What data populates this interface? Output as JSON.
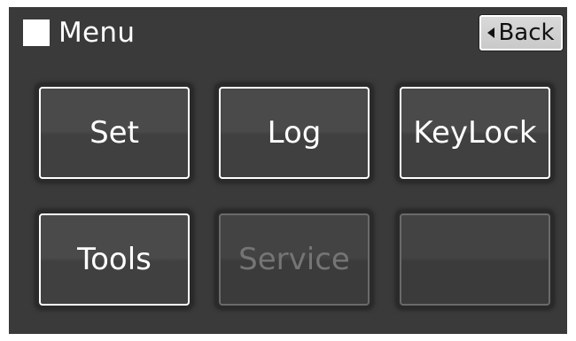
{
  "header": {
    "title": "Menu",
    "back_label": "Back"
  },
  "tiles": [
    {
      "label": "Set",
      "enabled": true
    },
    {
      "label": "Log",
      "enabled": true
    },
    {
      "label": "KeyLock",
      "enabled": true
    },
    {
      "label": "Tools",
      "enabled": true
    },
    {
      "label": "Service",
      "enabled": false
    },
    {
      "label": "",
      "enabled": false
    }
  ],
  "colors": {
    "screen_background": "#3a3a3a",
    "tile_border_enabled": "#ffffff",
    "tile_text_disabled": "#757575"
  }
}
